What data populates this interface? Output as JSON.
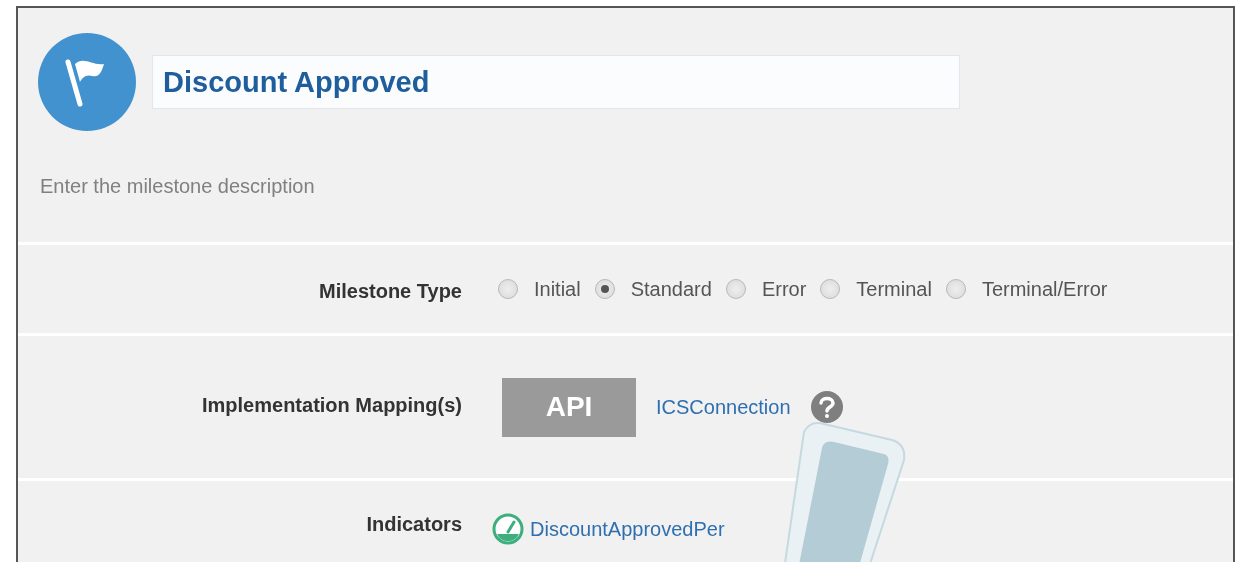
{
  "milestone": {
    "title": "Discount Approved",
    "description_placeholder": "Enter the milestone description"
  },
  "milestone_type": {
    "label": "Milestone Type",
    "options": [
      {
        "label": "Initial",
        "selected": false
      },
      {
        "label": "Standard",
        "selected": true
      },
      {
        "label": "Error",
        "selected": false
      },
      {
        "label": "Terminal",
        "selected": false
      },
      {
        "label": "Terminal/Error",
        "selected": false
      }
    ]
  },
  "implementation": {
    "label": "Implementation Mapping(s)",
    "badge": "API",
    "connection": "ICSConnection"
  },
  "indicators": {
    "label": "Indicators",
    "items": [
      "DiscountApprovedPer"
    ]
  }
}
